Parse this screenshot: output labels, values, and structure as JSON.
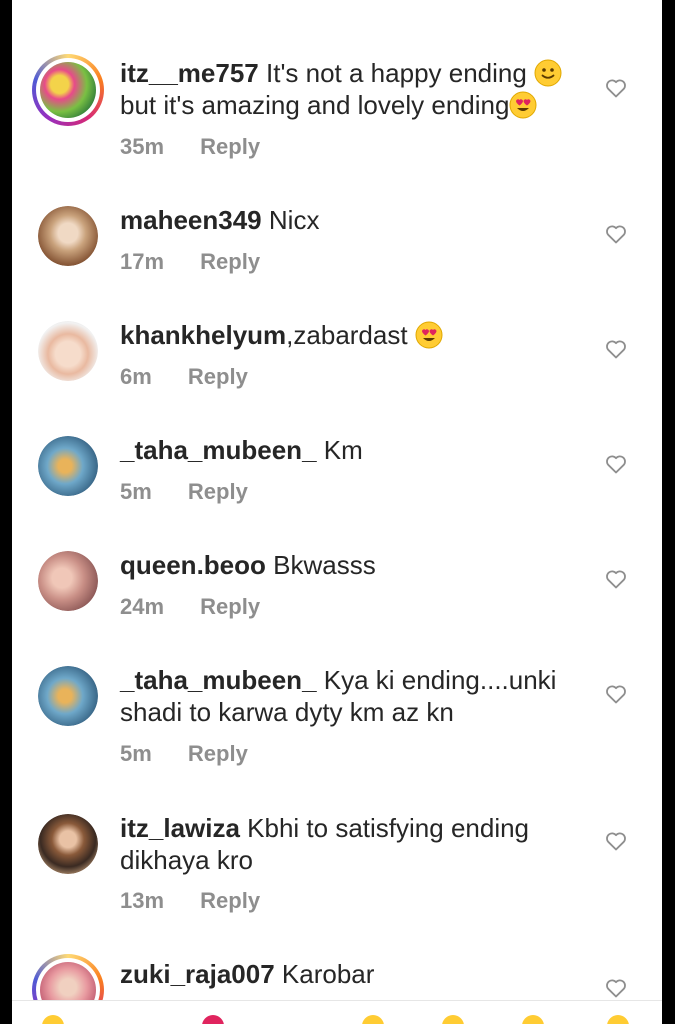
{
  "comments": [
    {
      "username": "itz__me757",
      "text_line1": "It's not a happy ending",
      "emoji1": "slightly-smiling-face-emoji",
      "text_line2": "but it's amazing and lovely ending",
      "emoji2": "heart-eyes-emoji",
      "time": "35m",
      "reply": "Reply"
    },
    {
      "username": "maheen349",
      "text": "Nicx",
      "time": "17m",
      "reply": "Reply"
    },
    {
      "username": "khankhelyum",
      "text": ",zabardast",
      "emoji": "heart-eyes-emoji",
      "time": "6m",
      "reply": "Reply"
    },
    {
      "username": "_taha_mubeen_",
      "text": "Km",
      "time": "5m",
      "reply": "Reply"
    },
    {
      "username": "queen.beoo",
      "text": "Bkwasss",
      "time": "24m",
      "reply": "Reply"
    },
    {
      "username": "_taha_mubeen_",
      "text_line1": "Kya ki ending....unki",
      "text_line2": "shadi to karwa dyty km az kn",
      "time": "5m",
      "reply": "Reply"
    },
    {
      "username": "itz_lawiza",
      "text_line1": "Kbhi to satisfying ending",
      "text_line2": "dikhaya kro",
      "time": "13m",
      "reply": "Reply"
    },
    {
      "username": "zuki_raja007",
      "text": "Karobar"
    }
  ],
  "icons": {
    "like": "heart-outline-icon"
  },
  "colors": {
    "text": "#262626",
    "meta": "#8e8e8e",
    "background": "#ffffff",
    "story_ring": "#d62976"
  }
}
